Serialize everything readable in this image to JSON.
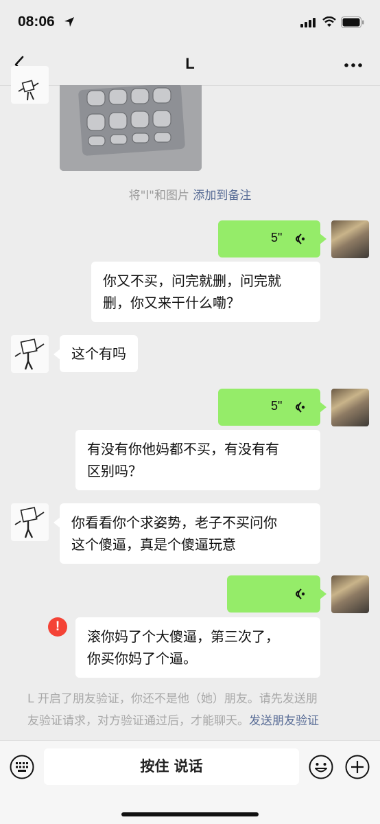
{
  "status_bar": {
    "time": "08:06"
  },
  "chat": {
    "title": "L"
  },
  "system_note": {
    "prefix": "将\"l\"和图片",
    "link": "添加到备注"
  },
  "messages": {
    "voice1": {
      "duration": "5\"",
      "transcript": [
        "你又不买，问完就删，问完就",
        "删，你又来干什么嘞？"
      ]
    },
    "text1": {
      "text": "这个有吗"
    },
    "voice2": {
      "duration": "5\"",
      "transcript": [
        "有没有你他妈都不买，有没有有",
        "区别吗？"
      ]
    },
    "text2": {
      "lines": [
        "你看看你个求姿势，老子不买问你",
        "这个傻逼，真是个傻逼玩意"
      ]
    },
    "voice3": {
      "duration": "",
      "transcript": [
        "滚你妈了个大傻逼，第三次了，",
        "你买你妈了个逼。"
      ]
    }
  },
  "error": {
    "icon_text": "!"
  },
  "notice": {
    "line1": "L 开启了朋友验证，你还不是他（她）朋友。请先发送朋",
    "line2_prefix": "友验证请求，对方验证通过后，才能聊天。",
    "link": "发送朋友验证"
  },
  "input": {
    "hold_to_talk": "按住 说话"
  },
  "colors": {
    "bubble_me": "#95ec69",
    "link": "#576b95",
    "error": "#f44336",
    "background": "#ededed"
  }
}
